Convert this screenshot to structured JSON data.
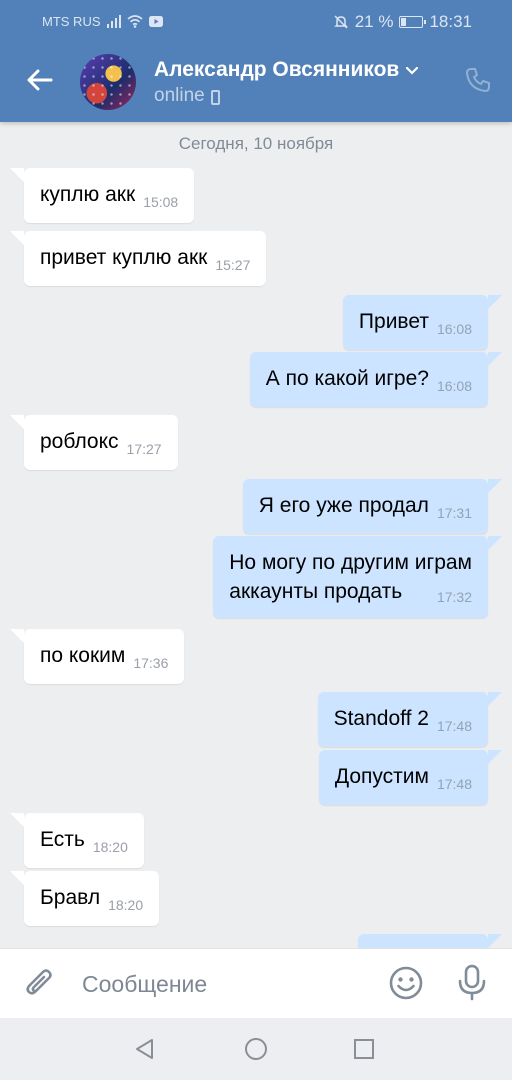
{
  "status_bar": {
    "carrier": "MTS RUS",
    "battery": "21 %",
    "time": "18:31"
  },
  "header": {
    "contact_name": "Александр Овсянников",
    "presence": "online"
  },
  "date_separator": "Сегодня, 10 ноября",
  "messages": [
    {
      "dir": "in",
      "text": "куплю акк",
      "time": "15:08"
    },
    {
      "dir": "in",
      "text": "привет куплю акк",
      "time": "15:27"
    },
    {
      "dir": "out",
      "text": "Привет",
      "time": "16:08"
    },
    {
      "dir": "out",
      "text": "А по какой игре?",
      "time": "16:08"
    },
    {
      "dir": "in",
      "text": "роблокс",
      "time": "17:27"
    },
    {
      "dir": "out",
      "text": "Я его уже продал",
      "time": "17:31"
    },
    {
      "dir": "out",
      "text_line1": "Но могу по другим играм",
      "text_line2": "аккаунты продать",
      "time": "17:32"
    },
    {
      "dir": "in",
      "text": "по коким",
      "time": "17:36"
    },
    {
      "dir": "out",
      "text": "Standoff 2",
      "time": "17:48"
    },
    {
      "dir": "out",
      "text": "Допустим",
      "time": "17:48"
    },
    {
      "dir": "in",
      "text": "Есть",
      "time": "18:20"
    },
    {
      "dir": "in",
      "text": "Бравл",
      "time": "18:20"
    }
  ],
  "composer": {
    "placeholder": "Сообщение"
  },
  "colors": {
    "header": "#5181b8",
    "background": "#edeef0",
    "outgoing": "#cce4ff",
    "incoming": "#ffffff"
  },
  "icons": [
    "back-arrow-icon",
    "chevron-down-icon",
    "phone-call-icon",
    "attach-icon",
    "emoji-icon",
    "microphone-icon",
    "nav-back-icon",
    "nav-home-icon",
    "nav-recent-icon"
  ]
}
